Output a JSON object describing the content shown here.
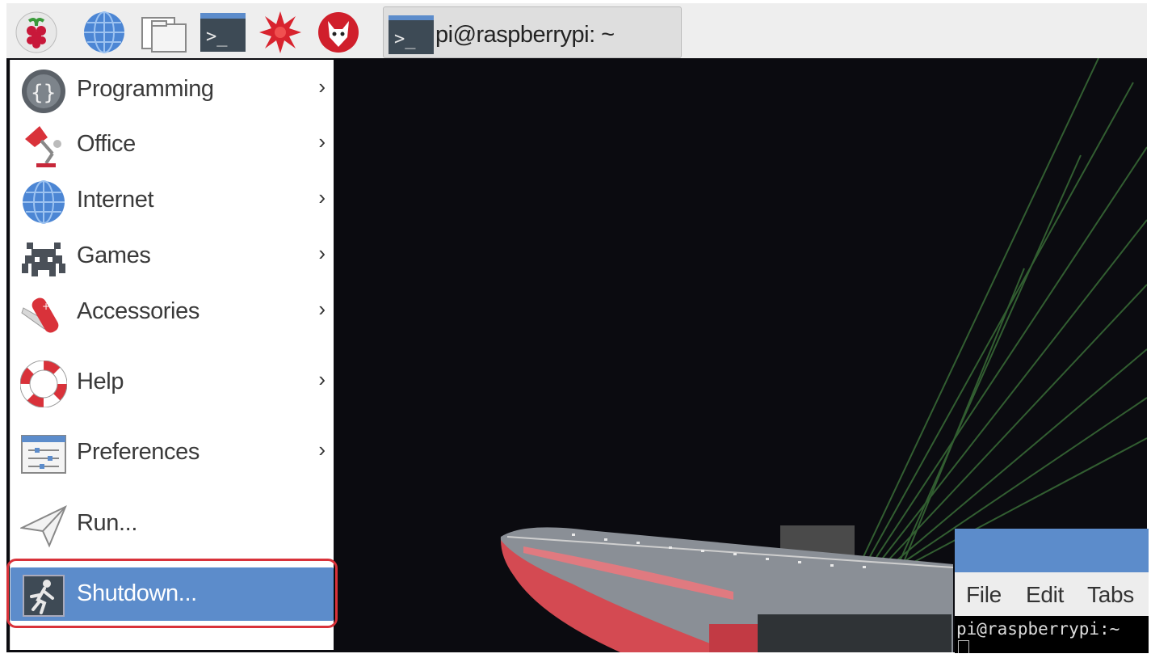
{
  "taskbar": {
    "launchers": [
      {
        "icon": "raspberry-menu-icon"
      },
      {
        "icon": "web-browser-globe-icon"
      },
      {
        "icon": "file-manager-folder-icon"
      },
      {
        "icon": "terminal-icon"
      },
      {
        "icon": "mathematica-star-icon"
      },
      {
        "icon": "wolfram-icon"
      }
    ],
    "task_button": {
      "label": "pi@raspberrypi: ~",
      "icon": "terminal-icon"
    }
  },
  "menu": {
    "items": [
      {
        "label": "Programming",
        "icon": "programming-icon",
        "submenu": true
      },
      {
        "label": "Office",
        "icon": "office-lamp-icon",
        "submenu": true
      },
      {
        "label": "Internet",
        "icon": "internet-globe-icon",
        "submenu": true
      },
      {
        "label": "Games",
        "icon": "games-invader-icon",
        "submenu": true
      },
      {
        "label": "Accessories",
        "icon": "accessories-knife-icon",
        "submenu": true
      },
      {
        "label": "Help",
        "icon": "help-lifebuoy-icon",
        "submenu": true
      },
      {
        "label": "Preferences",
        "icon": "preferences-icon",
        "submenu": true
      },
      {
        "label": "Run...",
        "icon": "run-paper-plane-icon",
        "submenu": false
      },
      {
        "label": "Shutdown...",
        "icon": "shutdown-exit-icon",
        "submenu": false,
        "selected": true
      }
    ],
    "arrow_glyph": "›"
  },
  "terminal": {
    "menu": [
      "File",
      "Edit",
      "Tabs"
    ],
    "prompt": "pi@raspberrypi:~"
  },
  "colors": {
    "selection": "#5c8ccb",
    "highlight_ring": "#d9323a",
    "desktop_bg": "#0b0b10"
  }
}
